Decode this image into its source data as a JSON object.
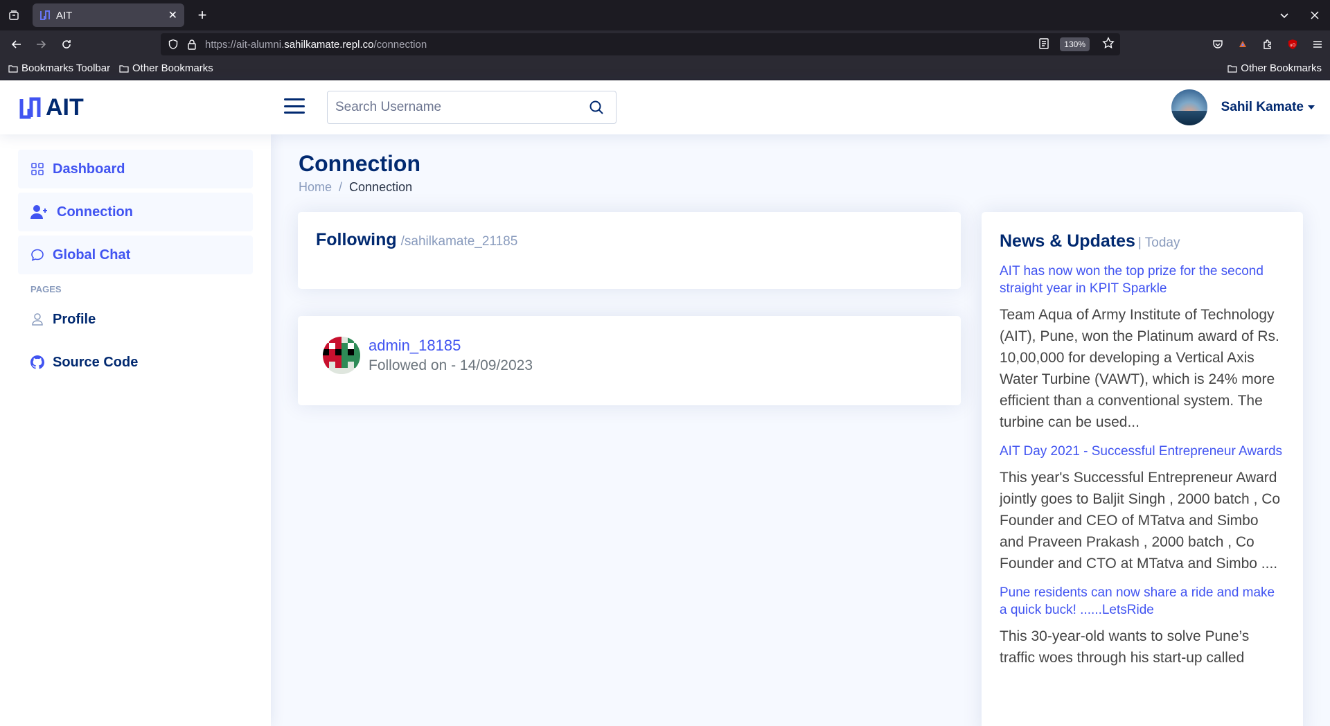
{
  "browser": {
    "tab_title": "AIT",
    "url_prefix": "https://ait-alumni.",
    "url_domain": "sahilkamate.repl.co",
    "url_path": "/connection",
    "zoom": "130%",
    "bookmarks_toolbar": "Bookmarks Toolbar",
    "other_bookmarks_left": "Other Bookmarks",
    "other_bookmarks_right": "Other Bookmarks"
  },
  "header": {
    "logo_text": "AIT",
    "search_placeholder": "Search Username",
    "user_name": "Sahil Kamate"
  },
  "sidebar": {
    "items": [
      {
        "label": "Dashboard",
        "icon": "grid-icon"
      },
      {
        "label": "Connection",
        "icon": "person-plus-icon"
      },
      {
        "label": "Global Chat",
        "icon": "chat-icon"
      }
    ],
    "heading": "PAGES",
    "pages": [
      {
        "label": "Profile",
        "icon": "person-icon"
      },
      {
        "label": "Source Code",
        "icon": "github-icon"
      }
    ]
  },
  "main": {
    "title": "Connection",
    "breadcrumb": {
      "home": "Home",
      "sep": "/",
      "current": "Connection"
    },
    "following_card": {
      "title": "Following",
      "handle": "/sahilkamate_21185"
    },
    "connection": {
      "username": "admin_18185",
      "followed_on": "Followed on - 14/09/2023"
    }
  },
  "news": {
    "title": "News & Updates",
    "subtitle": "| Today",
    "items": [
      {
        "title": "AIT has now won the top prize for the second straight year in KPIT Sparkle",
        "body": "Team Aqua of Army Institute of Technology (AIT), Pune, won the Platinum award of Rs. 10,00,000 for developing a Vertical Axis Water Turbine (VAWT), which is 24% more efficient than a conventional system. The turbine can be used..."
      },
      {
        "title": "AIT Day 2021 - Successful Entrepreneur Awards",
        "body": "This year's Successful Entrepreneur Award jointly goes to Baljit Singh , 2000 batch , Co Founder and CEO of MTatva and Simbo and Praveen Prakash , 2000 batch , Co Founder and CTO at MTatva and Simbo ...."
      },
      {
        "title": "Pune residents can now share a ride and make a quick buck! ......LetsRide",
        "body": "This 30-year-old wants to solve Pune’s traffic woes through his start-up called"
      }
    ]
  }
}
